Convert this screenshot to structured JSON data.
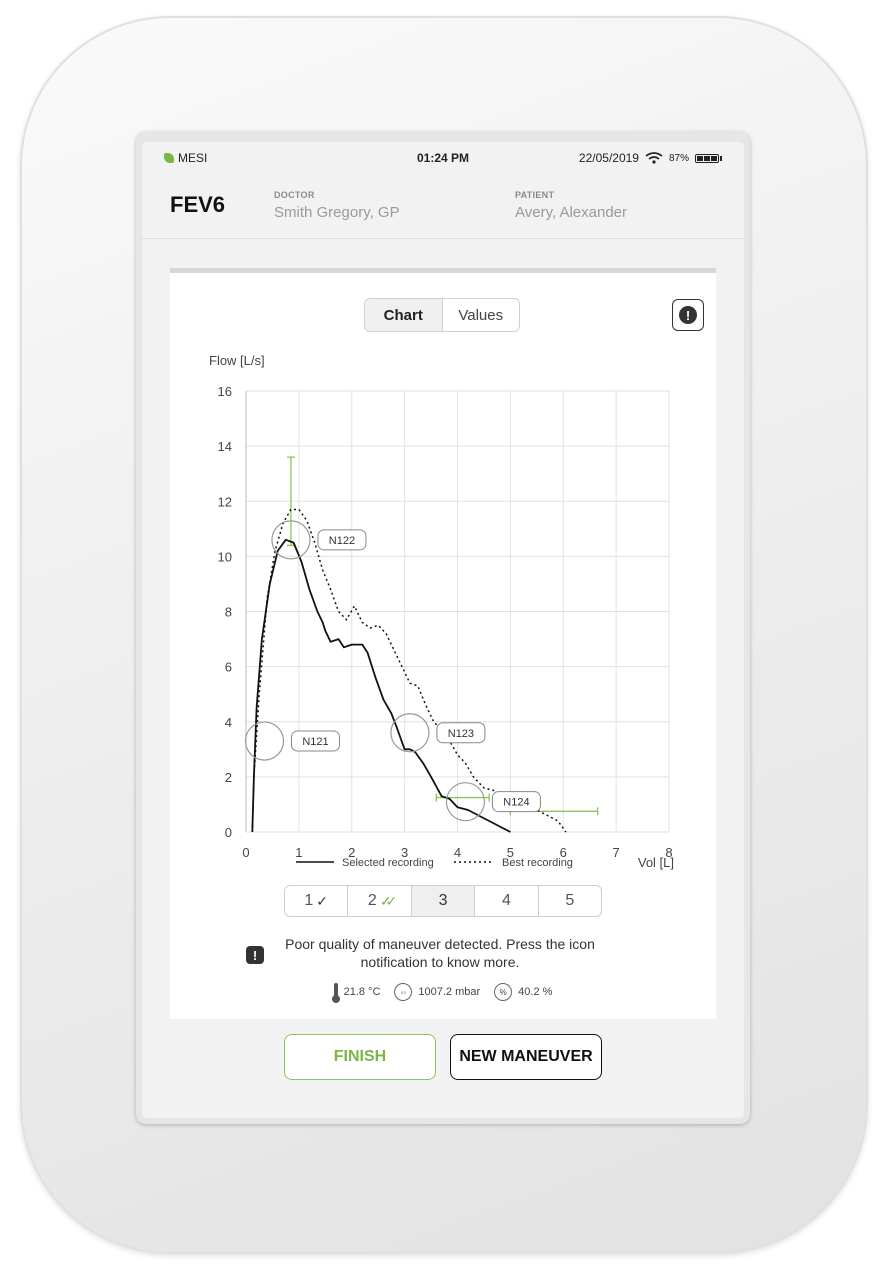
{
  "statusbar": {
    "brand": "MESI",
    "time": "01:24 PM",
    "date": "22/05/2019",
    "battery": "87%"
  },
  "header": {
    "title": "FEV6",
    "doctor_label": "DOCTOR",
    "doctor_value": "Smith Gregory, GP",
    "patient_label": "PATIENT",
    "patient_value": "Avery, Alexander"
  },
  "view_toggle": {
    "chart": "Chart",
    "values": "Values",
    "selected": "Chart"
  },
  "alert_icon": "exclamation-icon",
  "chart_data": {
    "type": "line",
    "ylabel": "Flow [L/s]",
    "xlabel": "Vol [L]",
    "xlim": [
      0,
      8
    ],
    "ylim": [
      0,
      16
    ],
    "xticks": [
      "0",
      "1",
      "2",
      "3",
      "4",
      "5",
      "6",
      "7",
      "8"
    ],
    "yticks": [
      "0",
      "2",
      "4",
      "6",
      "8",
      "10",
      "12",
      "14",
      "16"
    ],
    "grid": true,
    "legend_position": "bottom",
    "series": [
      {
        "name": "Selected recording",
        "style": "solid",
        "x": [
          0.12,
          0.15,
          0.2,
          0.3,
          0.45,
          0.6,
          0.75,
          0.9,
          1.05,
          1.2,
          1.35,
          1.45,
          1.5,
          1.6,
          1.75,
          1.85,
          2.0,
          2.1,
          2.2,
          2.3,
          2.45,
          2.6,
          2.75,
          2.85,
          3.0,
          3.1,
          3.2,
          3.35,
          3.5,
          3.7,
          3.85,
          4.0,
          4.2,
          4.4,
          4.6,
          4.8,
          5.0
        ],
        "y": [
          0.0,
          2.0,
          4.5,
          7.0,
          9.0,
          10.2,
          10.6,
          10.5,
          9.8,
          8.8,
          8.0,
          7.6,
          7.3,
          6.9,
          7.0,
          6.7,
          6.8,
          6.8,
          6.8,
          6.5,
          5.6,
          4.8,
          4.3,
          3.8,
          3.0,
          3.0,
          2.9,
          2.5,
          2.0,
          1.3,
          1.2,
          0.9,
          0.8,
          0.6,
          0.4,
          0.2,
          0.0
        ]
      },
      {
        "name": "Best recording",
        "style": "dotted",
        "x": [
          0.12,
          0.15,
          0.25,
          0.4,
          0.55,
          0.7,
          0.85,
          1.0,
          1.15,
          1.3,
          1.45,
          1.6,
          1.75,
          1.9,
          2.05,
          2.2,
          2.35,
          2.5,
          2.65,
          2.8,
          2.95,
          3.1,
          3.25,
          3.4,
          3.55,
          3.7,
          3.85,
          4.0,
          4.15,
          4.3,
          4.5,
          4.7,
          4.9,
          5.1,
          5.3,
          5.5,
          5.7,
          5.9,
          6.05
        ],
        "y": [
          0.0,
          2.0,
          5.0,
          8.5,
          10.2,
          11.2,
          11.7,
          11.7,
          11.3,
          10.5,
          9.5,
          8.8,
          8.0,
          7.7,
          8.2,
          7.6,
          7.4,
          7.5,
          7.2,
          6.6,
          6.0,
          5.4,
          5.3,
          4.6,
          4.0,
          3.7,
          3.3,
          2.8,
          2.5,
          2.0,
          1.6,
          1.5,
          1.3,
          1.1,
          0.9,
          0.8,
          0.6,
          0.4,
          0.0
        ]
      }
    ],
    "annotations": [
      {
        "label": "N121",
        "x": 0.35,
        "y": 3.3
      },
      {
        "label": "N122",
        "x": 0.85,
        "y": 10.6
      },
      {
        "label": "N123",
        "x": 3.1,
        "y": 3.6
      },
      {
        "label": "N124",
        "x": 4.15,
        "y": 1.1
      }
    ],
    "error_bars": [
      {
        "x": 0.85,
        "y_low": 10.4,
        "y_high": 13.6,
        "orientation": "vertical"
      },
      {
        "y": 1.25,
        "x_low": 3.6,
        "x_high": 4.6,
        "orientation": "horizontal"
      },
      {
        "y": 0.75,
        "x_low": 5.0,
        "x_high": 6.65,
        "orientation": "horizontal"
      }
    ],
    "accent_color": "#8cc45a"
  },
  "maneuvers": [
    {
      "label": "1",
      "status": "check"
    },
    {
      "label": "2",
      "status": "double-check"
    },
    {
      "label": "3",
      "status": "selected"
    },
    {
      "label": "4",
      "status": ""
    },
    {
      "label": "5",
      "status": ""
    }
  ],
  "warning": {
    "icon": "exclamation-icon",
    "text": "Poor quality of maneuver detected. Press the icon notification to know more."
  },
  "environment": {
    "temperature": "21.8 °C",
    "pressure": "1007.2 mbar",
    "humidity": "40.2 %",
    "humidity_symbol": "%"
  },
  "actions": {
    "finish": "FINISH",
    "new_maneuver": "NEW MANEUVER"
  },
  "colors": {
    "accent": "#7ab648",
    "text": "#222222",
    "muted": "#9a9a9a"
  }
}
